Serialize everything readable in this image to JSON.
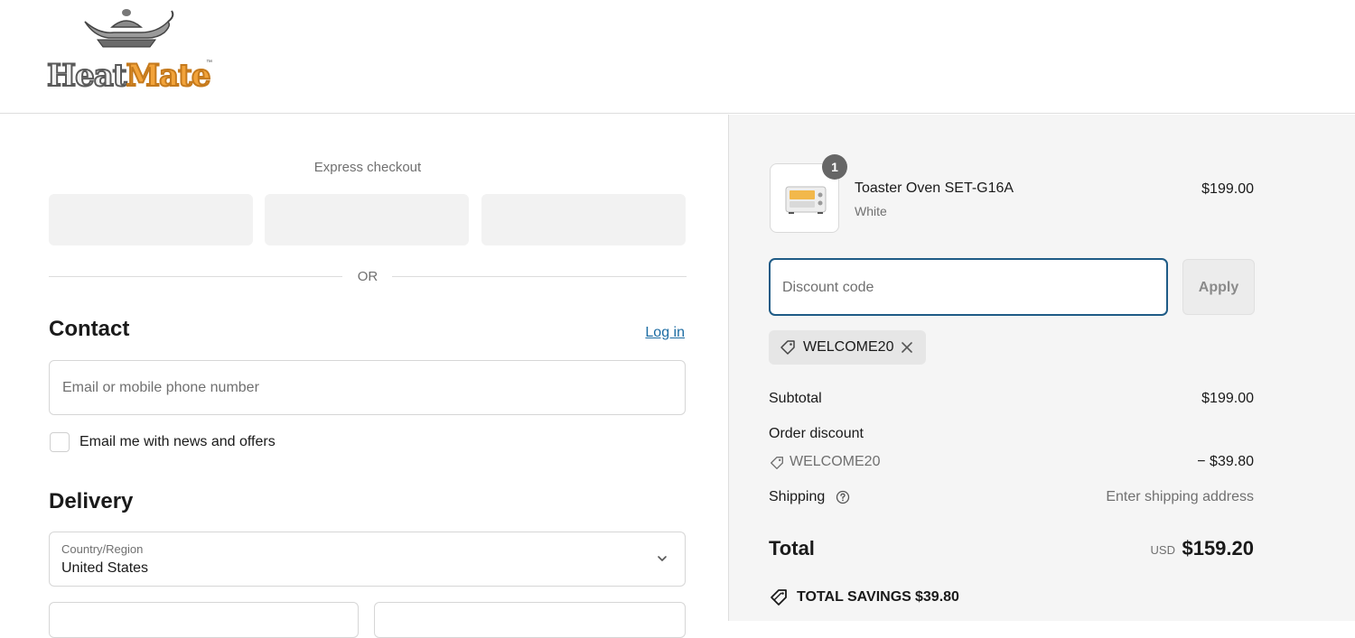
{
  "header": {
    "brand_part1": "Heat",
    "brand_part2": "Mate",
    "brand_tm": "™"
  },
  "checkout": {
    "express_label": "Express checkout",
    "or_label": "OR",
    "contact": {
      "title": "Contact",
      "login_link": "Log in",
      "email_placeholder": "Email or mobile phone number",
      "newsletter_label": "Email me with news and offers"
    },
    "delivery": {
      "title": "Delivery",
      "country_label": "Country/Region",
      "country_value": "United States"
    }
  },
  "summary": {
    "item": {
      "quantity": "1",
      "name": "Toaster Oven SET-G16A",
      "variant": "White",
      "price": "$199.00"
    },
    "discount": {
      "placeholder": "Discount code",
      "apply_label": "Apply",
      "applied_code": "WELCOME20"
    },
    "subtotal_label": "Subtotal",
    "subtotal_value": "$199.00",
    "order_discount_label": "Order discount",
    "order_discount_code": "WELCOME20",
    "order_discount_value": "− $39.80",
    "shipping_label": "Shipping",
    "shipping_value": "Enter shipping address",
    "total_label": "Total",
    "total_currency": "USD",
    "total_value": "$159.20",
    "savings_label": "TOTAL SAVINGS",
    "savings_value": "$39.80"
  },
  "colors": {
    "accent_link": "#1c6ca3",
    "focus_border": "#1e5b86",
    "brand_orange": "#f2a33a"
  }
}
